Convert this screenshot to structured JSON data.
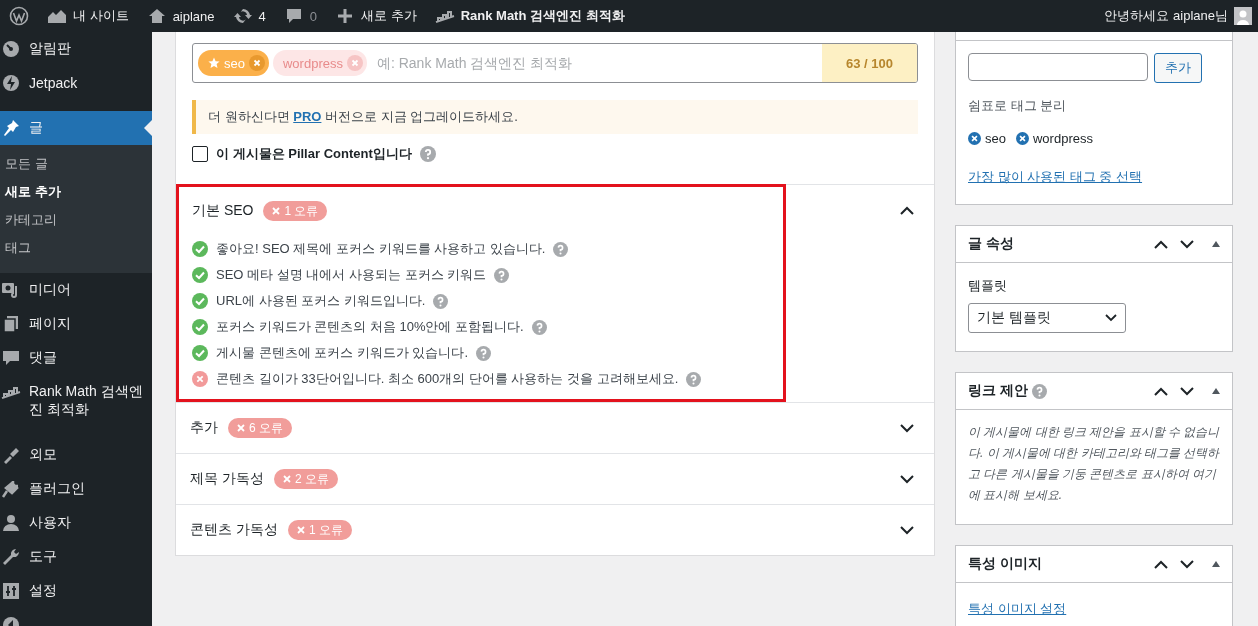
{
  "admin_bar": {
    "items": [
      {
        "kind": "wp-logo"
      },
      {
        "kind": "site",
        "label": "내 사이트"
      },
      {
        "kind": "home",
        "label": "aiplane"
      },
      {
        "kind": "updates",
        "label": "4"
      },
      {
        "kind": "comments",
        "label": "0"
      },
      {
        "kind": "new",
        "label": "새로 추가"
      },
      {
        "kind": "rankmath",
        "label": "Rank Math 검색엔진 최적화"
      }
    ],
    "greeting": "안녕하세요 aiplane님"
  },
  "sidebar": {
    "items": [
      {
        "kind": "dashboard",
        "label": "알림판",
        "selected": false
      },
      {
        "kind": "jetpack",
        "label": "Jetpack",
        "selected": false
      },
      {
        "kind": "posts",
        "label": "글",
        "selected": true,
        "children": [
          {
            "label": "모든 글",
            "selected": false
          },
          {
            "label": "새로 추가",
            "selected": true
          },
          {
            "label": "카테고리",
            "selected": false
          },
          {
            "label": "태그",
            "selected": false
          }
        ]
      },
      {
        "kind": "media",
        "label": "미디어",
        "selected": false
      },
      {
        "kind": "pages",
        "label": "페이지",
        "selected": false
      },
      {
        "kind": "comments",
        "label": "댓글",
        "selected": false
      },
      {
        "kind": "rankmath",
        "label": "Rank Math 검색엔진 최적화",
        "selected": false
      },
      {
        "kind": "appearance",
        "label": "외모",
        "selected": false
      },
      {
        "kind": "plugins",
        "label": "플러그인",
        "selected": false
      },
      {
        "kind": "users",
        "label": "사용자",
        "selected": false
      },
      {
        "kind": "tools",
        "label": "도구",
        "selected": false
      },
      {
        "kind": "settings",
        "label": "설정",
        "selected": false
      },
      {
        "kind": "collapse",
        "selected": false
      }
    ]
  },
  "keywords": {
    "tags": [
      {
        "label": "seo",
        "primary": true
      },
      {
        "label": "wordpress",
        "primary": false
      }
    ],
    "placeholder": "예: Rank Math 검색엔진 최적화",
    "score": "63 / 100"
  },
  "notice": {
    "before": "더 원하신다면 ",
    "link": "PRO",
    "after": " 버전으로 지금 업그레이드하세요."
  },
  "pillar": {
    "label": "이 게시물은 Pillar Content입니다",
    "checked": false
  },
  "sections": [
    {
      "title": "기본 SEO",
      "badge": "1 오류",
      "expanded": true,
      "highlighted": true,
      "checks": [
        {
          "text": "좋아요! SEO 제목에 포커스 키워드를 사용하고 있습니다.",
          "passed": true
        },
        {
          "text": "SEO 메타 설명 내에서 사용되는 포커스 키워드",
          "passed": true
        },
        {
          "text": "URL에 사용된 포커스 키워드입니다.",
          "passed": true
        },
        {
          "text": "포커스 키워드가 콘텐츠의 처음 10%안에 포함됩니다.",
          "passed": true
        },
        {
          "text": "게시물 콘텐츠에 포커스 키워드가 있습니다.",
          "passed": true
        },
        {
          "text": "콘텐츠 길이가 33단어입니다. 최소 600개의 단어를 사용하는 것을 고려해보세요.",
          "passed": false
        }
      ]
    },
    {
      "title": "추가",
      "badge": "6 오류",
      "expanded": false,
      "highlighted": false
    },
    {
      "title": "제목 가독성",
      "badge": "2 오류",
      "expanded": false,
      "highlighted": false
    },
    {
      "title": "콘텐츠 가독성",
      "badge": "1 오류",
      "expanded": false,
      "highlighted": false
    }
  ],
  "tags_box": {
    "button": "추가",
    "hint": "쉼표로 태그 분리",
    "tags": [
      "seo",
      "wordpress"
    ],
    "link": "가장 많이 사용된 태그 중 선택"
  },
  "post_attributes": {
    "title": "글 속성",
    "template_label": "템플릿",
    "template": "기본 템플릿"
  },
  "link_suggestions": {
    "title": "링크 제안",
    "message": "이 게시물에 대한 링크 제안을 표시할 수 없습니다. 이 게시물에 대한 카테고리와 태그를 선택하고 다른 게시물을 기둥 콘텐츠로 표시하여 여기에 표시해 보세요."
  },
  "featured_image": {
    "title": "특성 이미지",
    "link": "특성 이미지 설정"
  }
}
